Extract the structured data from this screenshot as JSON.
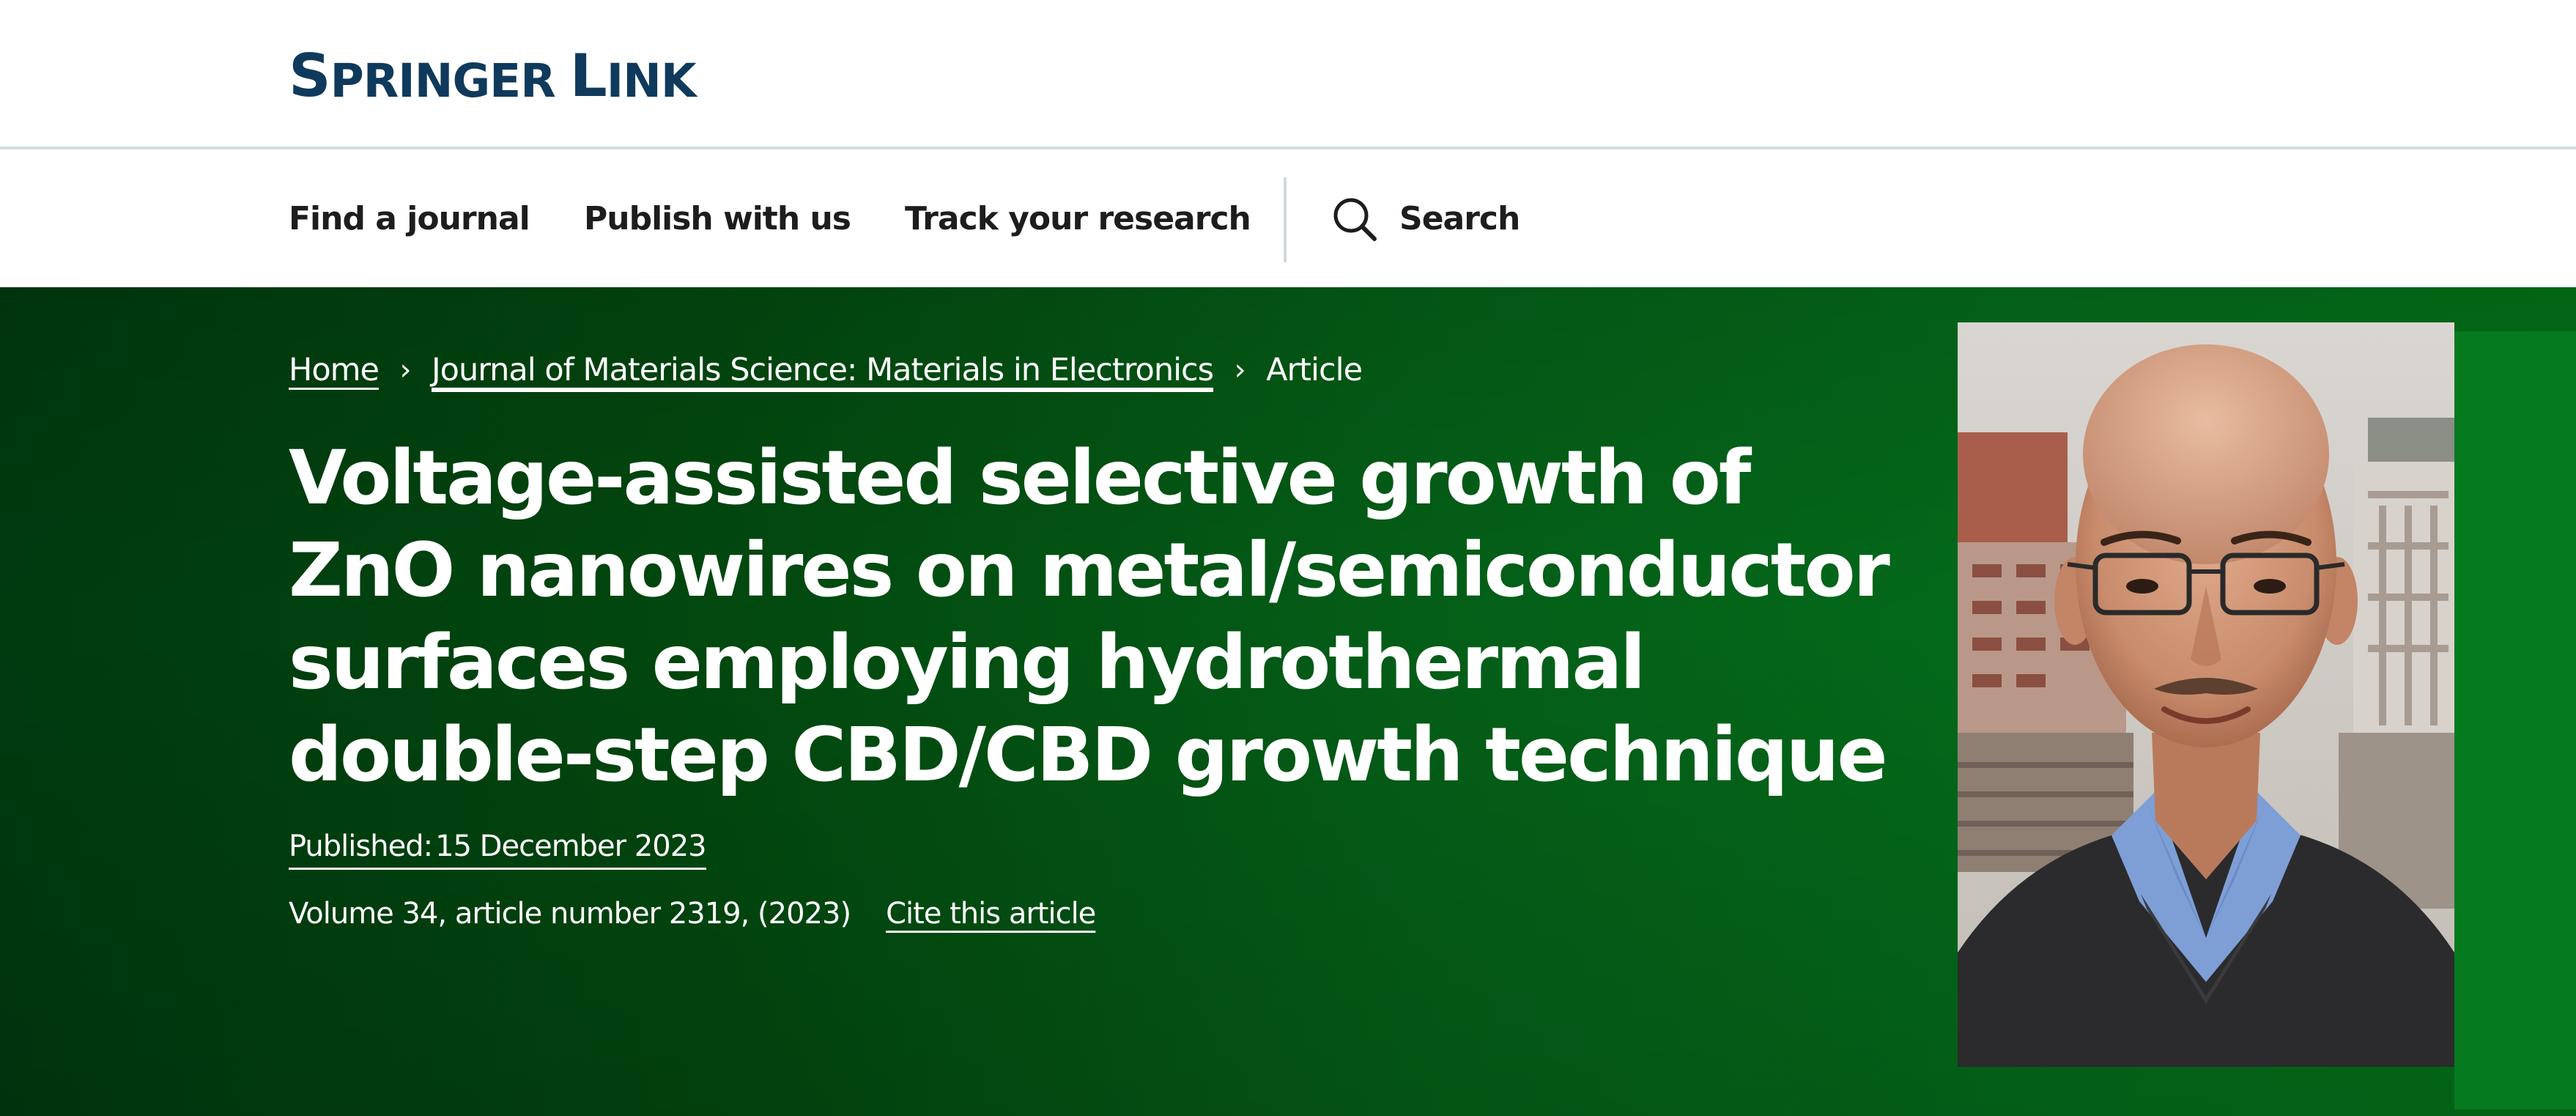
{
  "header": {
    "logo_word1_initial": "S",
    "logo_word1_rest": "PRINGER",
    "logo_word2_initial": "L",
    "logo_word2_rest": "INK"
  },
  "nav": {
    "items": [
      {
        "label": "Find a journal"
      },
      {
        "label": "Publish with us"
      },
      {
        "label": "Track your research"
      }
    ],
    "search_label": "Search"
  },
  "breadcrumb": {
    "home": "Home",
    "journal": "Journal of Materials Science: Materials in Electronics",
    "current": "Article",
    "separator": "›"
  },
  "article": {
    "title": "Voltage-assisted selective growth of ZnO nanowires on metal/semiconductor surfaces employing hydrothermal double-step CBD/CBD growth technique",
    "published_label": "Published:",
    "published_date": "15 December 2023",
    "volume_info": "Volume 34, article number 2319, (2023)",
    "cite_label": "Cite this article"
  },
  "colors": {
    "brand": "#0f3a5c",
    "hero_dark": "#003a0f",
    "hero_light": "#037018",
    "side_panel": "#067a1f"
  }
}
